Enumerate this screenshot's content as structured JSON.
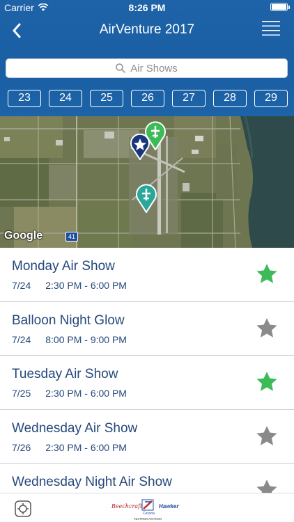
{
  "status_bar": {
    "carrier": "Carrier",
    "time": "8:26 PM"
  },
  "nav": {
    "title": "AirVenture 2017",
    "back_icon": "chevron-left-icon",
    "menu_icon": "hamburger-menu-icon"
  },
  "search": {
    "placeholder": "Air Shows"
  },
  "dates": [
    "23",
    "24",
    "25",
    "26",
    "27",
    "28",
    "29"
  ],
  "map": {
    "attribution": "Google",
    "road_label": "41",
    "pins": [
      {
        "kind": "star",
        "color": "#18377a"
      },
      {
        "kind": "plane",
        "color": "#3dbb58"
      },
      {
        "kind": "plane",
        "color": "#2aa79b"
      }
    ]
  },
  "events": [
    {
      "title": "Monday Air Show",
      "date": "7/24",
      "time": "2:30 PM - 6:00 PM",
      "favorite": true
    },
    {
      "title": "Balloon Night Glow",
      "date": "7/24",
      "time": "8:00 PM - 9:00 PM",
      "favorite": false
    },
    {
      "title": "Tuesday Air Show",
      "date": "7/25",
      "time": "2:30 PM - 6:00 PM",
      "favorite": true
    },
    {
      "title": "Wednesday Air Show",
      "date": "7/26",
      "time": "2:30 PM - 6:00 PM",
      "favorite": false
    },
    {
      "title": "Wednesday Night Air Show",
      "date": "",
      "time": "",
      "favorite": false
    }
  ],
  "tab_bar": {
    "settings_icon": "settings-gear-icon",
    "sponsors": {
      "left": "Beechcraft",
      "middle": "Cessna",
      "right": "Hawker",
      "caption": "TEXTRON AVIATION"
    }
  },
  "colors": {
    "header_blue": "#1a5fa3",
    "text_blue": "#24487c",
    "star_on": "#3dbb58",
    "star_off": "#8a8a8a"
  }
}
